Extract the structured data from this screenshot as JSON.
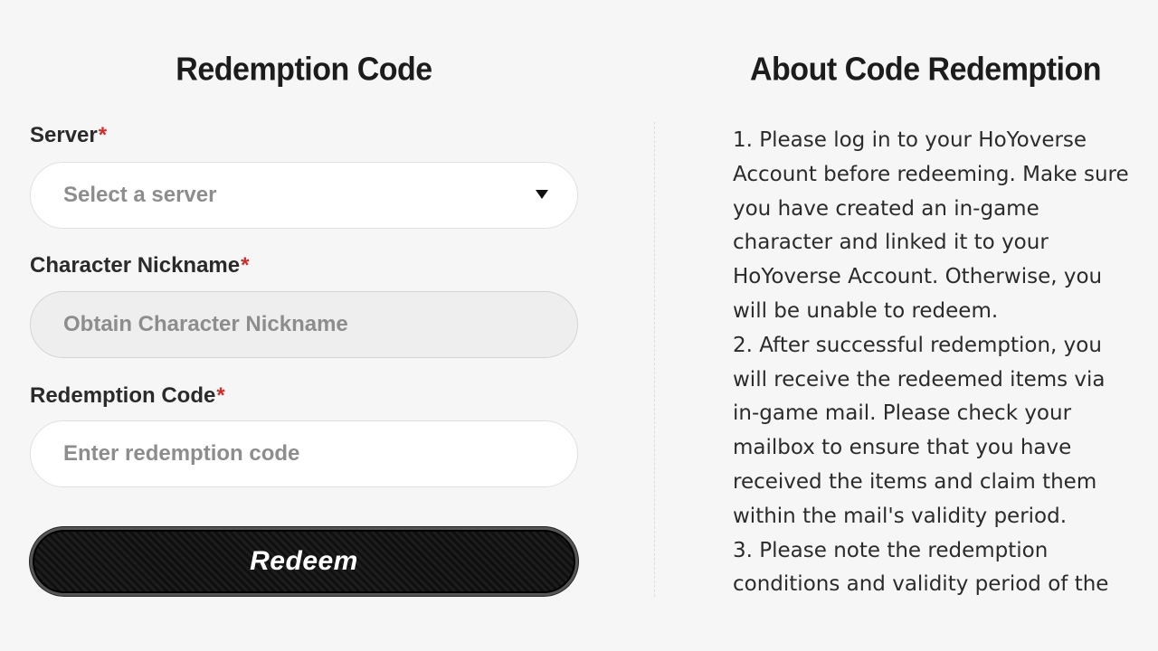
{
  "form": {
    "title": "Redemption Code",
    "server": {
      "label": "Server",
      "required_mark": "*",
      "selected_text": "Select a server"
    },
    "nickname": {
      "label": "Character Nickname",
      "required_mark": "*",
      "placeholder": "Obtain Character Nickname"
    },
    "code": {
      "label": "Redemption Code",
      "required_mark": "*",
      "placeholder": "Enter redemption code",
      "value": ""
    },
    "redeem_button": "Redeem"
  },
  "info": {
    "title": "About Code Redemption",
    "items": [
      "1. Please log in to your HoYoverse Account before redeeming. Make sure you have created an in-game character and linked it to your HoYoverse Account. Otherwise, you will be unable to redeem.",
      "2. After successful redemption, you will receive the redeemed items via in-game mail. Please check your mailbox to ensure that you have received the items and claim them within the mail's validity period.",
      "3. Please note the redemption conditions and validity period of the"
    ]
  },
  "colors": {
    "background": "#f6f6f6",
    "required_mark": "#d12c2c",
    "button_bg": "#111111",
    "button_text": "#ffffff"
  },
  "icons": {
    "dropdown": "chevron-down-icon"
  }
}
